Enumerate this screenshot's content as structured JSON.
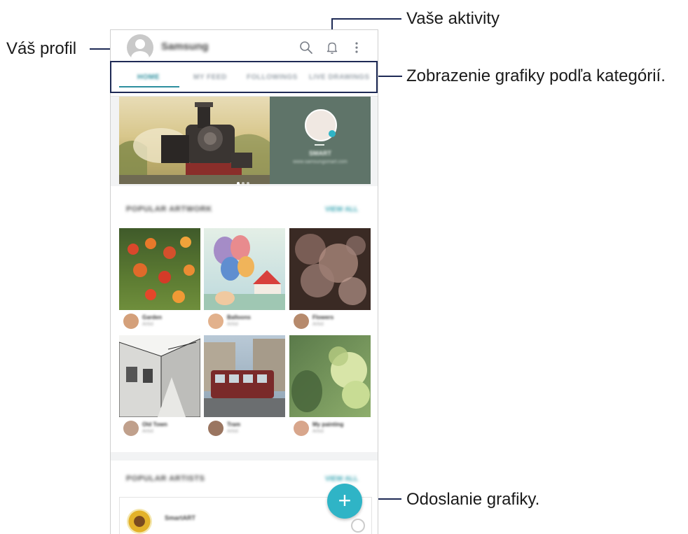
{
  "callouts": {
    "profile": "Váš profil",
    "activities": "Vaše aktivity",
    "categories": "Zobrazenie grafiky podľa kategórií.",
    "upload": "Odoslanie grafiky."
  },
  "app": {
    "name": "Samsung",
    "tabs": [
      "HOME",
      "MY FEED",
      "FOLLOWINGS",
      "LIVE DRAWINGS"
    ]
  },
  "banner": {
    "artist_name": "SMART",
    "artist_sub": "www.samsungsmart.com"
  },
  "popular_artwork": {
    "title": "POPULAR ARTWORK",
    "view_all": "VIEW ALL",
    "cards": [
      {
        "name": "Garden",
        "sub": "Artist"
      },
      {
        "name": "Balloons",
        "sub": "Artist"
      },
      {
        "name": "Flowers",
        "sub": "Artist"
      },
      {
        "name": "Old Town",
        "sub": "Artist"
      },
      {
        "name": "Tram",
        "sub": "Artist"
      },
      {
        "name": "My painting",
        "sub": "Artist"
      }
    ]
  },
  "popular_artists": {
    "title": "POPULAR ARTISTS",
    "view_all": "VIEW ALL",
    "first": "SmartART"
  },
  "colors": {
    "accent": "#2fb4c6",
    "tab_active": "#2d8f9e",
    "callout_line": "#1e2a55"
  }
}
